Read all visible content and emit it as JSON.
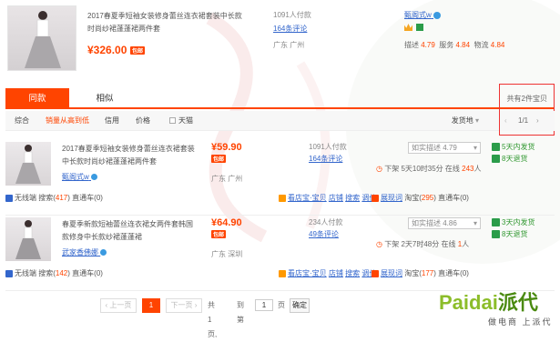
{
  "top": {
    "title": "2017春夏季短袖女装修身蕾丝连衣裙套装中长款时尚纱裙蓬蓬裙两件套",
    "price": "¥326.00",
    "tag": "包邮",
    "sales": "1091人付款",
    "comments": "164条评论",
    "location": "广东 广州",
    "shop": "甄阁式w",
    "scores": [
      {
        "label": "描述",
        "value": "4.79"
      },
      {
        "label": "服务",
        "value": "4.84"
      },
      {
        "label": "物流",
        "value": "4.84"
      }
    ]
  },
  "tabs": {
    "same": "同款",
    "similar": "相似",
    "count": "共有2件宝贝"
  },
  "sort": {
    "items": [
      "综合",
      "销量从高到低",
      "信用",
      "价格"
    ],
    "tmall": "天猫",
    "ship": "发货地",
    "page": "1/1",
    "prev": "‹",
    "next": "›"
  },
  "products": [
    {
      "title": "2017春夏季短袖女装修身蕾丝连衣裙套装中长款时尚纱裙蓬蓬裙两件套",
      "shop": "甄阁式w",
      "price": "¥59.90",
      "tag": "包邮",
      "location": "广东 广州",
      "sales": "1091人付款",
      "comments": "164条评论",
      "select": "如实描述 4.79",
      "badge1": "5天内发货",
      "badge2": "8天退货",
      "order_pre": "下架 5天10时35分 在线",
      "order_num": "243",
      "order_post": "人",
      "pkg_pre": "无线端",
      "pkg_mid": "搜索(",
      "pkg_num": "417",
      "pkg_post": ")  直通车(0)",
      "shop_link_pre": "看店宝·宝贝",
      "shop_link_mid": "店铺",
      "shop_link_a": "搜索",
      "shop_link_b": "调价",
      "tao_pre": "展现词",
      "tao_mid": "淘宝(",
      "tao_num": "295",
      "tao_post": ")  直通车(0)"
    },
    {
      "title": "春夏季新款短袖蕾丝连衣裙女两件套韩国款修身中长款纱裙蓬蓬裙",
      "shop": "武家香佛娜",
      "price": "¥64.90",
      "tag": "包邮",
      "location": "广东 深圳",
      "sales": "234人付款",
      "comments": "49条评论",
      "select": "如实描述 4.86",
      "badge1": "3天内发货",
      "badge2": "8天退货",
      "order_pre": "下架 2天7时48分 在线",
      "order_num": "1",
      "order_post": "人",
      "pkg_pre": "无线端",
      "pkg_mid": "搜索(",
      "pkg_num": "142",
      "pkg_post": ")  直通车(0)",
      "shop_link_pre": "看店宝·宝贝",
      "shop_link_mid": "店铺",
      "shop_link_a": "搜索",
      "shop_link_b": "调价",
      "tao_pre": "展现词",
      "tao_mid": "淘宝(",
      "tao_num": "177",
      "tao_post": ")  直通车(0)"
    }
  ],
  "pagination": {
    "prev": "‹ 上一页",
    "current": "1",
    "next": "下一页 ›",
    "total": "共 1 页,",
    "goto": "到第",
    "page_value": "1",
    "page_unit": "页",
    "confirm": "确定"
  },
  "watermark": {
    "brand_latin": "Paidai",
    "brand_cn": "派代",
    "slogan": "做电商 上派代"
  },
  "colors": {
    "accent": "#ff4400",
    "link": "#3366cc",
    "green": "#2b9c4a"
  }
}
